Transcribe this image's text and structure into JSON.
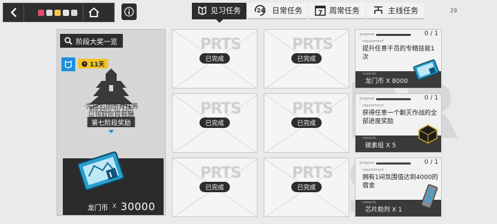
{
  "topbar": {
    "tabs": [
      {
        "label": "见习任务",
        "icon": "shield-book-icon",
        "active": true
      },
      {
        "label": "日常任务",
        "icon": "24h-cycle-icon",
        "active": false
      },
      {
        "label": "周常任务",
        "icon": "calendar-7-icon",
        "active": false
      },
      {
        "label": "主线任务",
        "icon": "tree-branch-icon",
        "active": false
      }
    ],
    "status_text": "29"
  },
  "left_panel": {
    "overview_label": "阶段大奖一览",
    "timer": "11天",
    "logo_text": "RHODES ISLAND",
    "description_line1": "·完成右侧所有任务",
    "description_line2": "以领取阶段报酬",
    "stage_button": "第七阶段奖励",
    "reward_name": "龙门币",
    "reward_x": "X",
    "reward_qty": "30000"
  },
  "grid": {
    "placeholder": "PRTS",
    "cells": [
      {
        "status": "已完成"
      },
      {
        "status": "已完成"
      },
      {
        "status": "已完成"
      },
      {
        "status": "已完成"
      },
      {
        "status": "已完成"
      },
      {
        "status": "已完成"
      }
    ]
  },
  "missions": [
    {
      "progress_label": "progress",
      "count": "0 / 1",
      "progress": 0,
      "req_label": "requirement",
      "text": "提升任意干员的专精技能1次",
      "rewards_label": "rewards",
      "reward": "龙门币 X 8000",
      "item_icon": "lmd-ticket-icon"
    },
    {
      "progress_label": "progress",
      "count": "0 / 1",
      "progress": 0,
      "req_label": "requirement",
      "text": "获得任意一个剿灭作战的全部进度奖励",
      "rewards_label": "rewards",
      "reward": "碳素组 X 5",
      "item_icon": "carbon-brick-icon"
    },
    {
      "progress_label": "progress",
      "count": "0 / 1",
      "progress": 0,
      "req_label": "requirement",
      "text": "拥有1间氛围值达到4000的宿舍",
      "rewards_label": "rewards",
      "reward": "芯片助剂 X 1",
      "item_icon": "chip-catalyst-icon"
    }
  ]
}
